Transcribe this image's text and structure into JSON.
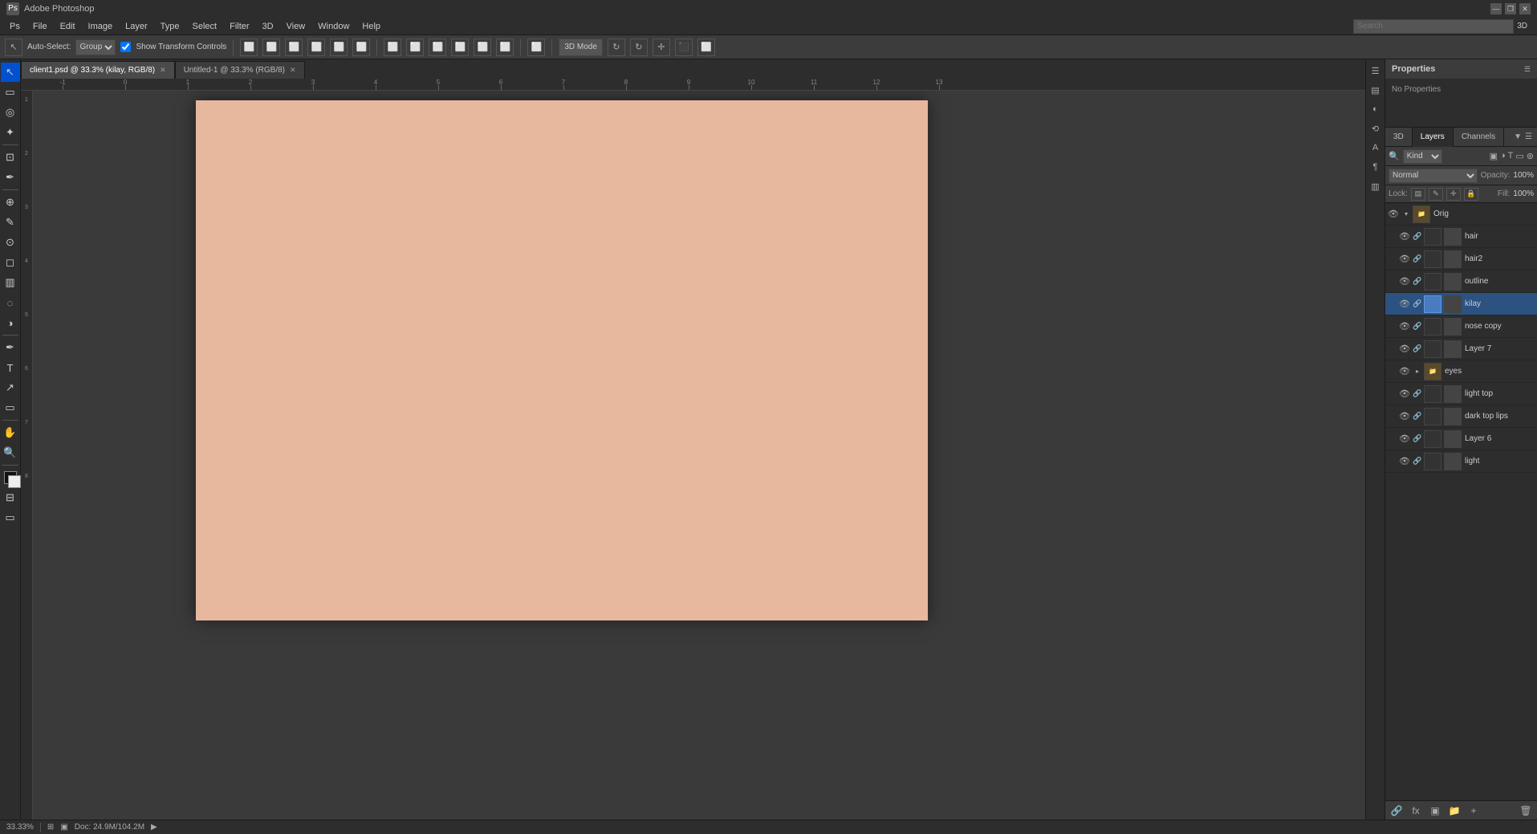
{
  "titleBar": {
    "title": "Adobe Photoshop",
    "windowControls": [
      "—",
      "❐",
      "✕"
    ]
  },
  "menuBar": {
    "items": [
      "Ps",
      "File",
      "Edit",
      "Image",
      "Layer",
      "Type",
      "Select",
      "Filter",
      "3D",
      "View",
      "Window",
      "Help"
    ]
  },
  "optionsBar": {
    "autoSelectLabel": "Auto-Select:",
    "groupDropdown": "Group",
    "showTransformControls": "Show Transform Controls",
    "threeDLabel": "3D",
    "threeDValue": "3D"
  },
  "tabs": [
    {
      "label": "client1.psd @ 33.3% (kilay, RGB/8)",
      "active": true
    },
    {
      "label": "Untitled-1 @ 33.3% (RGB/8)",
      "active": false
    }
  ],
  "properties": {
    "title": "Properties",
    "content": "No Properties"
  },
  "layersPanel": {
    "tabs": [
      "3D",
      "Layers",
      "Channels"
    ],
    "searchPlaceholder": "Kind",
    "blendMode": "Normal",
    "opacityLabel": "Opacity:",
    "opacityValue": "100%",
    "lockLabel": "Lock:",
    "fillLabel": "Fill:",
    "fillValue": "100%",
    "layers": [
      {
        "name": "Orig",
        "type": "group",
        "visible": true,
        "expanded": true,
        "indent": 0
      },
      {
        "name": "hair",
        "type": "layer",
        "visible": true,
        "indent": 1
      },
      {
        "name": "hair2",
        "type": "layer",
        "visible": true,
        "indent": 1
      },
      {
        "name": "outline",
        "type": "layer",
        "visible": true,
        "indent": 1
      },
      {
        "name": "kilay",
        "type": "layer",
        "visible": true,
        "indent": 1,
        "selected": true
      },
      {
        "name": "nose copy",
        "type": "layer",
        "visible": true,
        "indent": 1
      },
      {
        "name": "Layer 7",
        "type": "layer",
        "visible": true,
        "indent": 1
      },
      {
        "name": "eyes",
        "type": "group",
        "visible": true,
        "indent": 1
      },
      {
        "name": "light top",
        "type": "layer",
        "visible": true,
        "indent": 1
      },
      {
        "name": "dark top lips",
        "type": "layer",
        "visible": true,
        "indent": 1
      },
      {
        "name": "Layer 6",
        "type": "layer",
        "visible": true,
        "indent": 1
      },
      {
        "name": "light",
        "type": "layer",
        "visible": true,
        "indent": 1
      }
    ]
  },
  "statusBar": {
    "zoom": "33.33%",
    "docSize": "Doc: 24.9M/104.2M"
  },
  "canvas": {
    "backgroundColor": "#e8b89e"
  },
  "tools": [
    "move",
    "marquee",
    "lasso",
    "magic-wand",
    "crop",
    "eyedropper",
    "healing",
    "brush",
    "clone",
    "eraser",
    "gradient",
    "blur",
    "dodge",
    "pen",
    "text",
    "path-selection",
    "shape",
    "hand",
    "zoom",
    "foreground-bg"
  ],
  "rulerLabels": [
    "-1",
    "0",
    "1",
    "2",
    "3",
    "4",
    "5",
    "6",
    "7",
    "8",
    "9",
    "10",
    "11",
    "12",
    "13"
  ]
}
